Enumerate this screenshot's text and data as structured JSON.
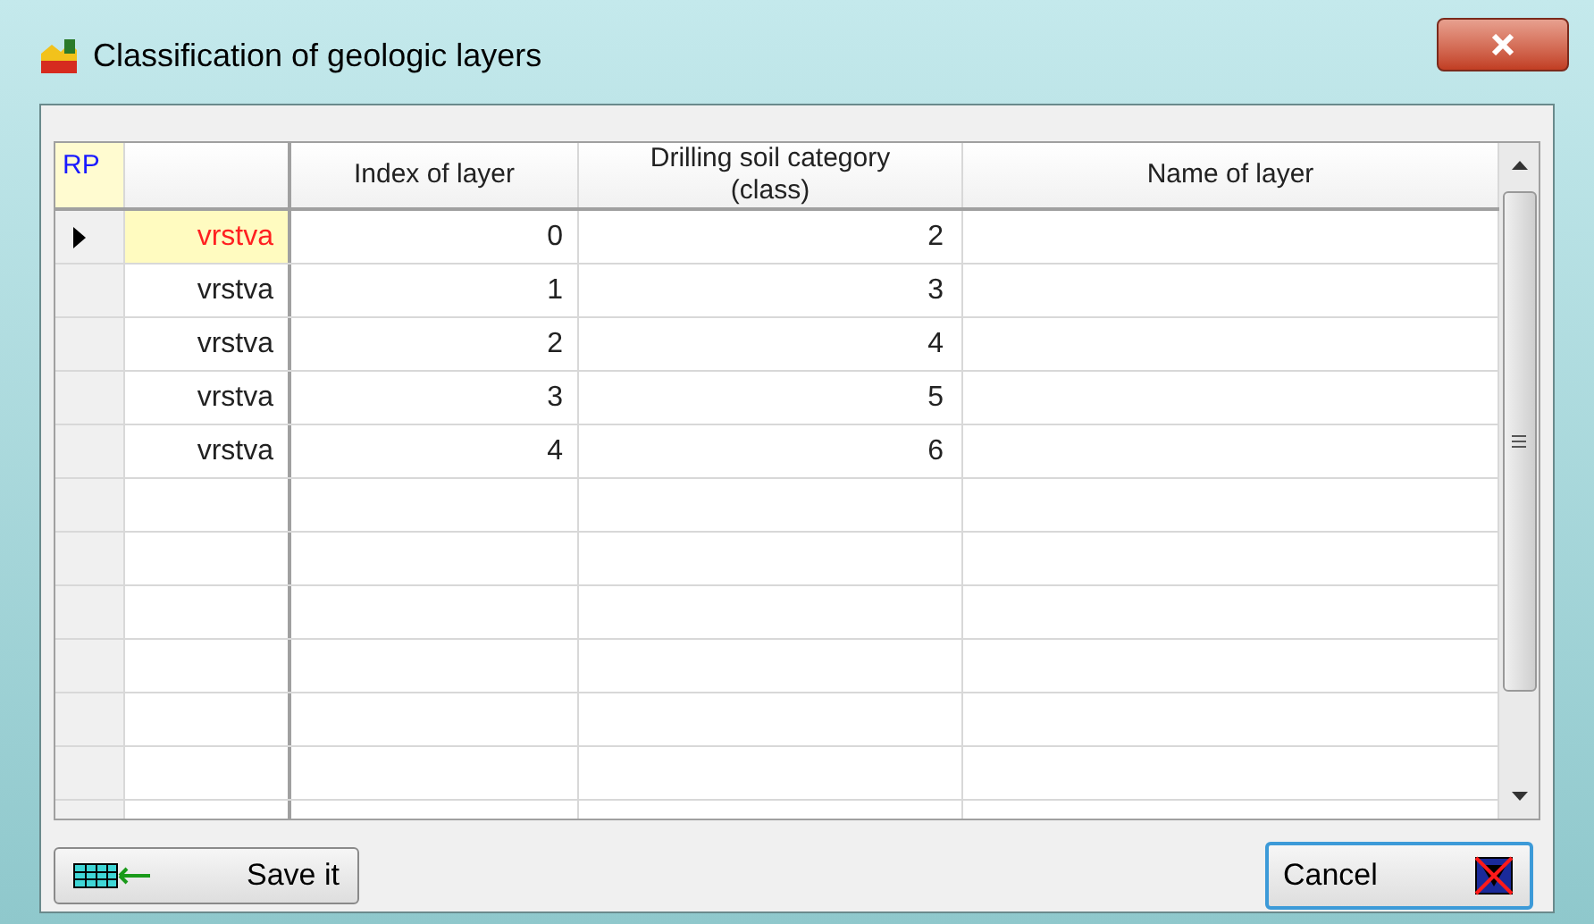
{
  "window": {
    "title": "Classification of geologic layers"
  },
  "table": {
    "corner": "RP",
    "columns": [
      "Index of layer",
      "Drilling soil category\n(class)",
      "Name of layer"
    ],
    "rows": [
      {
        "name": "vrstva",
        "index": "0",
        "category": "2",
        "selected": true
      },
      {
        "name": "vrstva",
        "index": "1",
        "category": "3",
        "selected": false
      },
      {
        "name": "vrstva",
        "index": "2",
        "category": "4",
        "selected": false
      },
      {
        "name": "vrstva",
        "index": "3",
        "category": "5",
        "selected": false
      },
      {
        "name": "vrstva",
        "index": "4",
        "category": "6",
        "selected": false
      }
    ]
  },
  "buttons": [
    {
      "kind": "save",
      "label": "Save it"
    },
    {
      "kind": "cancel",
      "label": "Cancel"
    }
  ]
}
